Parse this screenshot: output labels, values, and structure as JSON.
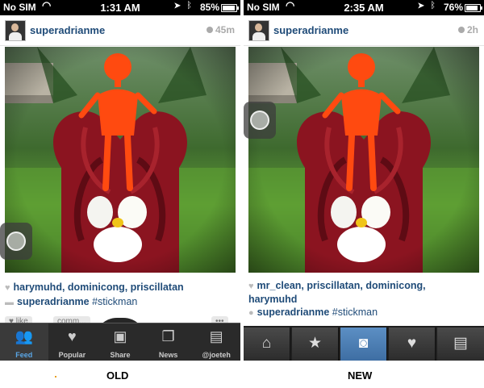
{
  "old": {
    "status": {
      "carrier": "No SIM",
      "wifi_icon": "wifi-icon",
      "time": "1:31 AM",
      "battery": "85%",
      "battery_level": 0.85
    },
    "post": {
      "username": "superadrianme",
      "timestamp": "45m"
    },
    "likes": {
      "heart_icon": "heart-icon",
      "users": "harymuhd, dominicong, priscillatan"
    },
    "caption": {
      "username": "superadrianme",
      "text": "#stickman"
    },
    "actions": {
      "like": "like",
      "comment": "comm...",
      "more": "•••"
    },
    "tabs": [
      {
        "label": "Feed",
        "icon": "people-icon",
        "active": true
      },
      {
        "label": "Popular",
        "icon": "heart-icon"
      },
      {
        "label": "Share",
        "icon": "camera-icon"
      },
      {
        "label": "News",
        "icon": "news-icon"
      },
      {
        "label": "@joeteh",
        "icon": "profile-card-icon"
      }
    ],
    "footer_label": "OLD"
  },
  "new": {
    "status": {
      "carrier": "No SIM",
      "wifi_icon": "wifi-icon",
      "time": "2:35 AM",
      "battery": "76%",
      "battery_level": 0.76
    },
    "post": {
      "username": "superadrianme",
      "timestamp": "2h"
    },
    "likes": {
      "heart_icon": "heart-icon",
      "users": "mr_clean, priscillatan, dominicong,",
      "users_line2": "harymuhd"
    },
    "caption": {
      "username": "superadrianme",
      "text": "#stickman"
    },
    "tabs": [
      {
        "icon": "home-icon"
      },
      {
        "icon": "star-icon"
      },
      {
        "icon": "camera-icon",
        "active": true
      },
      {
        "icon": "speech-bubble-icon"
      },
      {
        "icon": "profile-card-icon"
      }
    ],
    "footer_label": "NEW"
  }
}
